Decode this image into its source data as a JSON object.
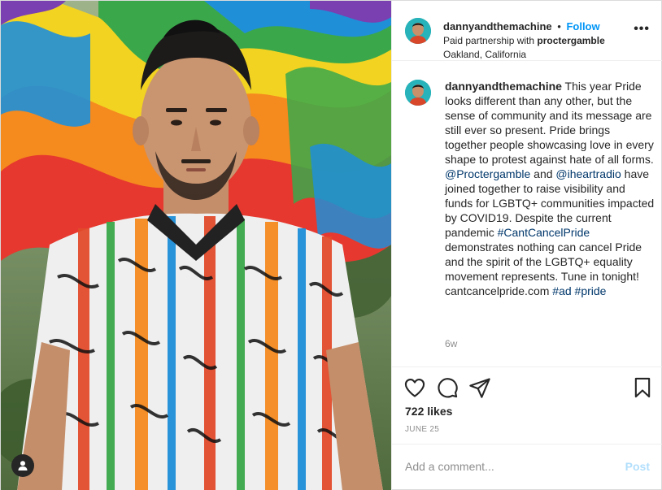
{
  "post": {
    "username": "dannyandthemachine",
    "follow_label": "Follow",
    "dot": "•",
    "partnership_prefix": "Paid partnership with ",
    "partner": "proctergamble",
    "location": "Oakland, California",
    "more_label": "•••"
  },
  "caption": {
    "username": "dannyandthemachine",
    "text_1": " This year Pride looks different than any other, but the sense of community and its message are still ever so present. Pride brings together people showcasing love in every shape to protest against hate of all forms. ",
    "mention_1": "@Proctergamble",
    "text_2": " and ",
    "mention_2": "@iheartradio",
    "text_3": " have joined together to raise visibility and funds for LGBTQ+ communities impacted by COVID19. Despite the current pandemic ",
    "hashtag_1": "#CantCancelPride",
    "text_4": " demonstrates nothing can cancel Pride and the spirit of the LGBTQ+ equality movement represents. Tune in tonight! cantcancelpride.com ",
    "hashtag_2": "#ad",
    "text_5": " ",
    "hashtag_3": "#pride",
    "time_ago": "6w"
  },
  "actions": {
    "like_icon": "heart-icon",
    "comment_icon": "comment-icon",
    "share_icon": "paper-plane-icon",
    "save_icon": "bookmark-icon",
    "likes": "722 likes",
    "date": "JUNE 25"
  },
  "comment_box": {
    "placeholder": "Add a comment...",
    "post_label": "Post"
  },
  "photo": {
    "user_tag_icon": "user-icon",
    "flag_colors": [
      "#e6382e",
      "#f58a1f",
      "#f3d321",
      "#3aa84a",
      "#1f8fd8",
      "#7a3fb0"
    ]
  },
  "colors": {
    "link": "#00376b",
    "follow": "#0095f6",
    "post_disabled": "#b2dffc",
    "muted": "#8e8e8e"
  }
}
